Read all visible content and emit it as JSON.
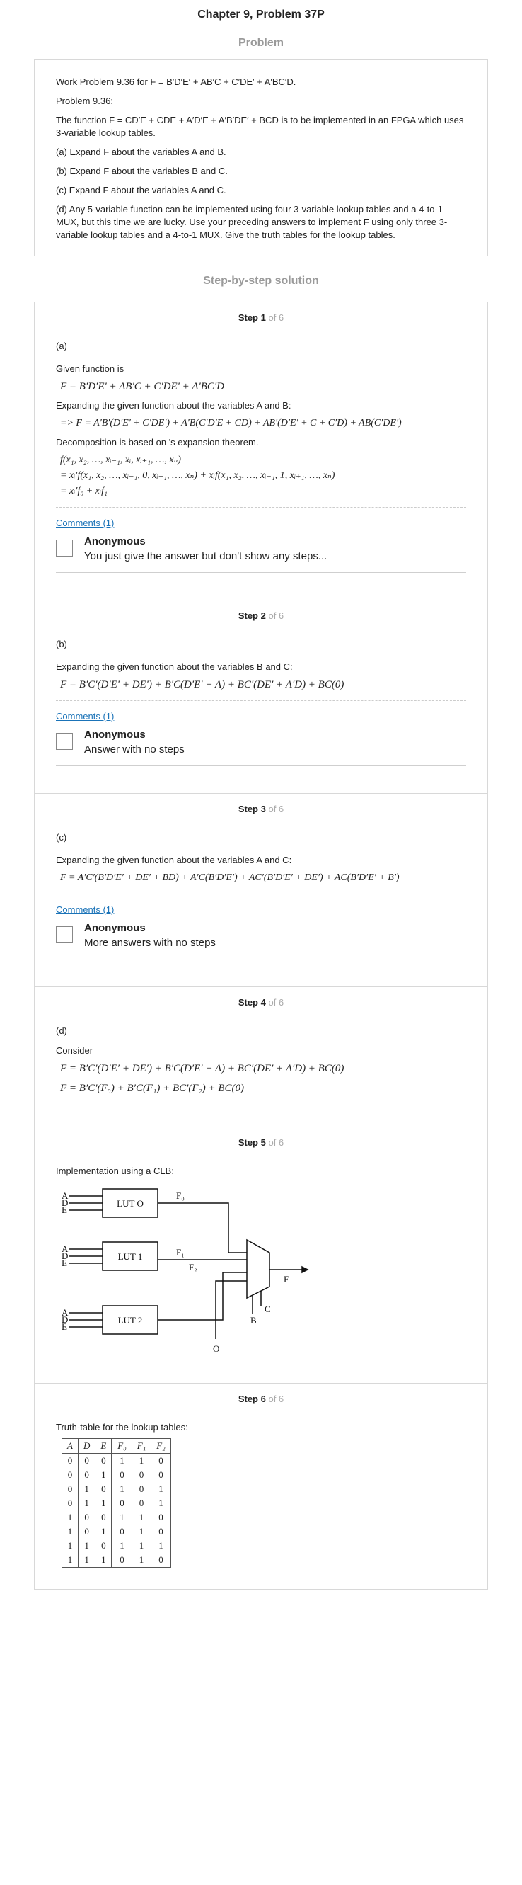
{
  "page": {
    "title": "Chapter 9, Problem 37P"
  },
  "problem": {
    "heading": "Problem",
    "paragraphs": [
      "Work Problem 9.36 for F = B′D′E′ + AB′C + C′DE′ + A′BC′D.",
      "Problem 9.36:",
      "The function F = CD′E + CDE + A′D′E + A′B′DE′ + BCD is to be implemented in an FPGA which uses 3-variable lookup tables.",
      "(a) Expand F about the variables A and B.",
      "(b) Expand F about the variables B and C.",
      "(c) Expand F about the variables A and C.",
      "(d) Any 5-variable function can be implemented using four 3-variable lookup tables and a 4-to-1 MUX, but this time we are lucky. Use your preceding answers to implement F using only three 3-variable lookup tables and a 4-to-1 MUX. Give the truth tables for the lookup tables."
    ]
  },
  "solution": {
    "heading": "Step-by-step solution",
    "steps": [
      {
        "label": "Step 1",
        "of": "of 6",
        "part": "(a)",
        "lines": [
          {
            "kind": "text",
            "v": "Given function is"
          },
          {
            "kind": "math",
            "v": "F = B′D′E′ + AB′C + C′DE′ + A′BC′D"
          },
          {
            "kind": "text",
            "v": "Expanding the given function about the variables A and B:"
          },
          {
            "kind": "math",
            "v": "=> F = A′B′(D′E′ + C′DE′) + A′B(C′D′E + CD) + AB′(D′E′ + C + C′D) + AB(C′DE′)"
          },
          {
            "kind": "text",
            "v": "Decomposition is based on 's expansion theorem."
          },
          {
            "kind": "math",
            "v": "f(x₁, x₂, …, xᵢ₋₁, xᵢ, xᵢ₊₁, …, xₙ)"
          },
          {
            "kind": "math",
            "v": "= xᵢ′f(x₁, x₂, …, xᵢ₋₁, 0, xᵢ₊₁, …, xₙ) + xᵢf(x₁, x₂, …, xᵢ₋₁, 1, xᵢ₊₁, …, xₙ)"
          },
          {
            "kind": "math",
            "v": "= xᵢ′f₀ + xᵢf₁"
          }
        ],
        "comments_link": "Comments (1)",
        "comment": {
          "author": "Anonymous",
          "text": "You just give the answer but don't show any steps..."
        }
      },
      {
        "label": "Step 2",
        "of": "of 6",
        "part": "(b)",
        "lines": [
          {
            "kind": "text",
            "v": "Expanding the given function about the variables B and C:"
          },
          {
            "kind": "math",
            "v": "F = B′C′(D′E′ + DE′) + B′C(D′E′ + A) + BC′(DE′ + A′D) + BC(0)"
          }
        ],
        "comments_link": "Comments (1)",
        "comment": {
          "author": "Anonymous",
          "text": "Answer with no steps"
        }
      },
      {
        "label": "Step 3",
        "of": "of 6",
        "part": "(c)",
        "lines": [
          {
            "kind": "text",
            "v": "Expanding the given function about the variables A and C:"
          },
          {
            "kind": "math",
            "v": "F = A′C′(B′D′E′ + DE′ + BD) + A′C(B′D′E′) + AC′(B′D′E′ + DE′) + AC(B′D′E′ + B′)"
          }
        ],
        "comments_link": "Comments (1)",
        "comment": {
          "author": "Anonymous",
          "text": "More answers with no steps"
        }
      },
      {
        "label": "Step 4",
        "of": "of 6",
        "part": "(d)",
        "lines": [
          {
            "kind": "text",
            "v": "Consider"
          },
          {
            "kind": "math",
            "v": "F = B′C′(D′E′ + DE′) + B′C(D′E′ + A) + BC′(DE′ + A′D) + BC(0)"
          },
          {
            "kind": "math",
            "v": "F = B′C′(F₀) + B′C(F₁) + BC′(F₂) + BC(0)"
          }
        ]
      },
      {
        "label": "Step 5",
        "of": "of 6",
        "intro": "Implementation using a CLB:",
        "diagram": {
          "luts": [
            "LUT  O",
            "LUT  1",
            "LUT  2"
          ],
          "inputs": [
            "A",
            "D",
            "E"
          ],
          "outputs": [
            "F₀",
            "F₁",
            "F₂"
          ],
          "mux_out": "F",
          "select_c": "C",
          "select_b": "B",
          "zero_input": "O"
        }
      },
      {
        "label": "Step 6",
        "of": "of 6",
        "intro": "Truth-table for the lookup tables:",
        "table": {
          "headers": [
            "A",
            "D",
            "E",
            "F₀",
            "F₁",
            "F₂"
          ],
          "rows": [
            [
              "0",
              "0",
              "0",
              "1",
              "1",
              "0"
            ],
            [
              "0",
              "0",
              "1",
              "0",
              "0",
              "0"
            ],
            [
              "0",
              "1",
              "0",
              "1",
              "0",
              "1"
            ],
            [
              "0",
              "1",
              "1",
              "0",
              "0",
              "1"
            ],
            [
              "1",
              "0",
              "0",
              "1",
              "1",
              "0"
            ],
            [
              "1",
              "0",
              "1",
              "0",
              "1",
              "0"
            ],
            [
              "1",
              "1",
              "0",
              "1",
              "1",
              "1"
            ],
            [
              "1",
              "1",
              "1",
              "0",
              "1",
              "0"
            ]
          ]
        }
      }
    ]
  }
}
